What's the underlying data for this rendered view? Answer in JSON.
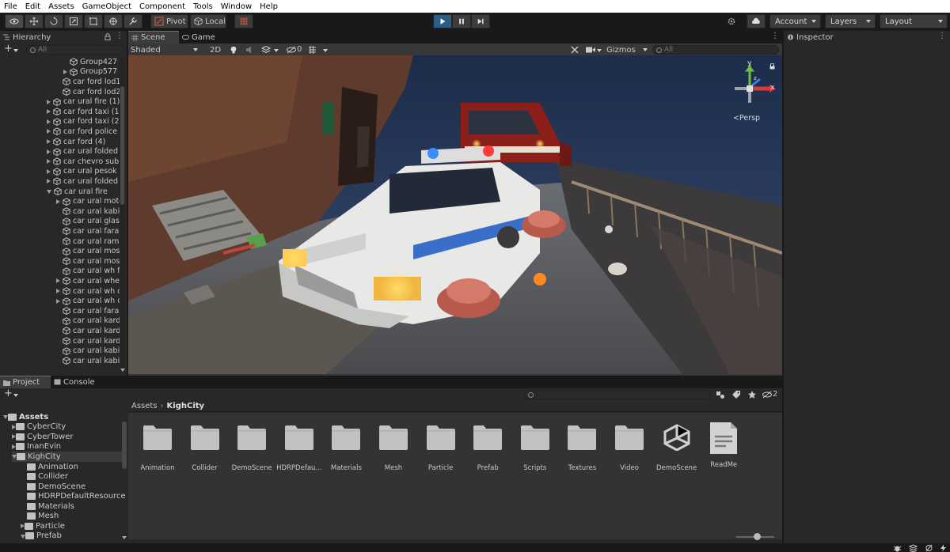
{
  "menu": [
    "File",
    "Edit",
    "Assets",
    "GameObject",
    "Component",
    "Tools",
    "Window",
    "Help"
  ],
  "toolbar": {
    "pivot_label": "Pivot",
    "local_label": "Local",
    "account_label": "Account",
    "layers_label": "Layers",
    "layout_label": "Layout"
  },
  "hierarchy": {
    "tab_label": "Hierarchy",
    "search_placeholder": "All",
    "items": [
      {
        "label": "Group427",
        "indent": 3,
        "arrow": "none"
      },
      {
        "label": "Group577",
        "indent": 3,
        "arrow": "right"
      },
      {
        "label": "car ford lod1",
        "indent": 2,
        "arrow": "none"
      },
      {
        "label": "car ford lod2",
        "indent": 2,
        "arrow": "none"
      },
      {
        "label": "car ural fire (1)",
        "indent": 1,
        "arrow": "right"
      },
      {
        "label": "car ford taxi (1",
        "indent": 1,
        "arrow": "right"
      },
      {
        "label": "car ford taxi (2",
        "indent": 1,
        "arrow": "right"
      },
      {
        "label": "car ford police",
        "indent": 1,
        "arrow": "right"
      },
      {
        "label": "car ford (4)",
        "indent": 1,
        "arrow": "right"
      },
      {
        "label": "car ural folded",
        "indent": 1,
        "arrow": "right"
      },
      {
        "label": "car chevro sub",
        "indent": 1,
        "arrow": "right"
      },
      {
        "label": "car ural pesok",
        "indent": 1,
        "arrow": "right"
      },
      {
        "label": "car ural folded",
        "indent": 1,
        "arrow": "right"
      },
      {
        "label": "car ural fire",
        "indent": 1,
        "arrow": "down"
      },
      {
        "label": "car ural moto",
        "indent": 2,
        "arrow": "right"
      },
      {
        "label": "car ural kabi",
        "indent": 2,
        "arrow": "none"
      },
      {
        "label": "car ural glas",
        "indent": 2,
        "arrow": "none"
      },
      {
        "label": "car ural fara",
        "indent": 2,
        "arrow": "none"
      },
      {
        "label": "car ural rama",
        "indent": 2,
        "arrow": "none"
      },
      {
        "label": "car ural mos",
        "indent": 2,
        "arrow": "none"
      },
      {
        "label": "car ural mos",
        "indent": 2,
        "arrow": "none"
      },
      {
        "label": "car ural wh f",
        "indent": 2,
        "arrow": "none"
      },
      {
        "label": "car ural whe",
        "indent": 2,
        "arrow": "right"
      },
      {
        "label": "car ural wh c",
        "indent": 2,
        "arrow": "right"
      },
      {
        "label": "car ural wh c",
        "indent": 2,
        "arrow": "right"
      },
      {
        "label": "car ural fara",
        "indent": 2,
        "arrow": "none"
      },
      {
        "label": "car ural kard",
        "indent": 2,
        "arrow": "none"
      },
      {
        "label": "car ural kard",
        "indent": 2,
        "arrow": "none"
      },
      {
        "label": "car ural kard",
        "indent": 2,
        "arrow": "none"
      },
      {
        "label": "car ural kabi",
        "indent": 2,
        "arrow": "none"
      },
      {
        "label": "car ural kabi",
        "indent": 2,
        "arrow": "none"
      }
    ]
  },
  "scene": {
    "tab_scene": "Scene",
    "tab_game": "Game",
    "shading_mode": "Shaded",
    "mode_2d": "2D",
    "hidden_count": "0",
    "gizmos_label": "Gizmos",
    "search_placeholder": "All",
    "persp_label": "<Persp",
    "axis_x": "x",
    "axis_y": "y",
    "axis_z": "z"
  },
  "inspector": {
    "tab_label": "Inspector"
  },
  "project": {
    "tab_project": "Project",
    "tab_console": "Console",
    "breadcrumb_root": "Assets",
    "breadcrumb_current": "KighCity",
    "hidden_count": "2",
    "tree": [
      {
        "label": "Assets",
        "indent": 0,
        "arrow": "down",
        "bold": true
      },
      {
        "label": "CyberCity",
        "indent": 1,
        "arrow": "right"
      },
      {
        "label": "CyberTower",
        "indent": 1,
        "arrow": "right"
      },
      {
        "label": "InanEvin",
        "indent": 1,
        "arrow": "right"
      },
      {
        "label": "KighCity",
        "indent": 1,
        "arrow": "down",
        "selected": true
      },
      {
        "label": "Animation",
        "indent": 2,
        "arrow": "none"
      },
      {
        "label": "Collider",
        "indent": 2,
        "arrow": "none"
      },
      {
        "label": "DemoScene",
        "indent": 2,
        "arrow": "none"
      },
      {
        "label": "HDRPDefaultResource",
        "indent": 2,
        "arrow": "none"
      },
      {
        "label": "Materials",
        "indent": 2,
        "arrow": "none"
      },
      {
        "label": "Mesh",
        "indent": 2,
        "arrow": "none"
      },
      {
        "label": "Particle",
        "indent": 2,
        "arrow": "right"
      },
      {
        "label": "Prefab",
        "indent": 2,
        "arrow": "down"
      }
    ],
    "items": [
      {
        "label": "Animation",
        "kind": "folder"
      },
      {
        "label": "Collider",
        "kind": "folder"
      },
      {
        "label": "DemoScene",
        "kind": "folder"
      },
      {
        "label": "HDRPDefau...",
        "kind": "folder"
      },
      {
        "label": "Materials",
        "kind": "folder"
      },
      {
        "label": "Mesh",
        "kind": "folder"
      },
      {
        "label": "Particle",
        "kind": "folder"
      },
      {
        "label": "Prefab",
        "kind": "folder"
      },
      {
        "label": "Scripts",
        "kind": "folder"
      },
      {
        "label": "Textures",
        "kind": "folder"
      },
      {
        "label": "Video",
        "kind": "folder"
      },
      {
        "label": "DemoScene",
        "kind": "unity-scene"
      },
      {
        "label": "ReadMe",
        "kind": "text-asset"
      }
    ]
  },
  "colors": {
    "accent_blue": "#2c5d87",
    "tab_accent": "#3a79bb",
    "panel": "#282828",
    "folder": "#c2c2c2"
  }
}
